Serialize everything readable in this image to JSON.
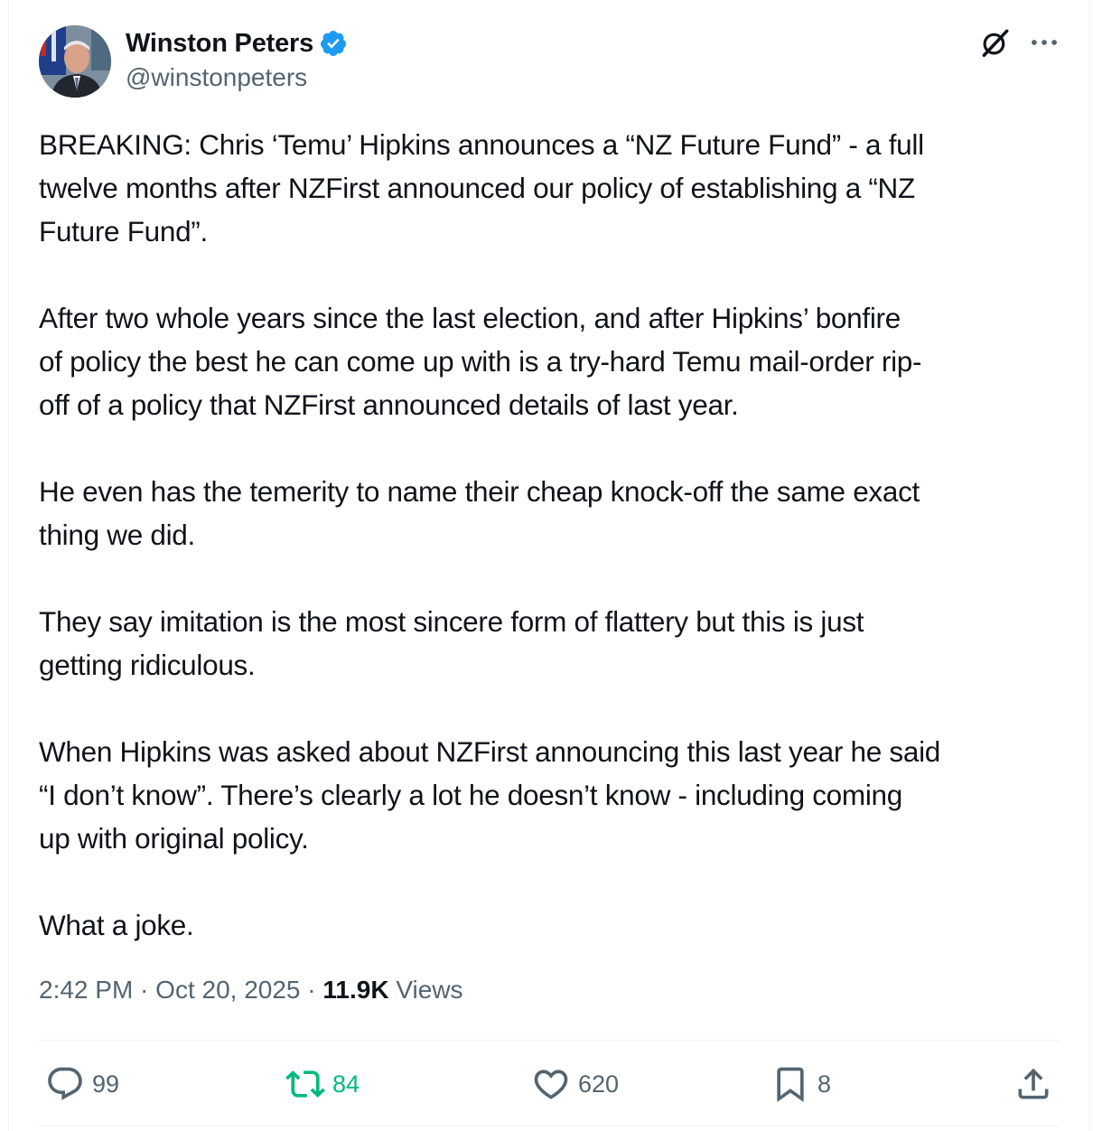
{
  "author": {
    "display_name": "Winston Peters",
    "handle": "@winstonpeters",
    "verified": true,
    "avatar_icon": "profile-photo"
  },
  "header_actions": {
    "grok_icon": "grok-icon",
    "more_icon": "more-dots-icon"
  },
  "tweet": {
    "paragraphs": [
      "BREAKING: Chris ‘Temu’ Hipkins announces a “NZ Future Fund” - a full\ntwelve months after NZFirst announced our policy of establishing a “NZ\nFuture Fund”.",
      "After two whole years since the last election, and after Hipkins’ bonfire\nof policy the best he can come up with is a try-hard Temu mail-order rip-\noff of a policy that NZFirst announced details of last year.",
      "He even has the temerity to name their cheap knock-off the same exact\nthing we did.",
      "They say imitation is the most sincere form of flattery but this is just\ngetting ridiculous.",
      "When Hipkins was asked about NZFirst announcing this last year he said\n“I don’t know”. There’s clearly a lot he doesn’t know - including coming\nup with original policy.",
      "What a joke."
    ]
  },
  "meta": {
    "time": "2:42 PM",
    "separator": " · ",
    "date": "Oct 20, 2025",
    "views_count": "11.9K",
    "views_label": " Views"
  },
  "actions": {
    "reply": {
      "count": "99",
      "icon": "reply-icon"
    },
    "retweet": {
      "count": "84",
      "icon": "retweet-icon",
      "color": "#00ba7c"
    },
    "like": {
      "count": "620",
      "icon": "heart-icon"
    },
    "bookmark": {
      "count": "8",
      "icon": "bookmark-icon"
    },
    "share": {
      "icon": "share-icon"
    }
  },
  "colors": {
    "verified_blue": "#1d9bf0",
    "secondary_text": "#536471",
    "primary_text": "#0f1419",
    "retweet_green": "#00ba7c",
    "divider": "#eff3f4"
  }
}
